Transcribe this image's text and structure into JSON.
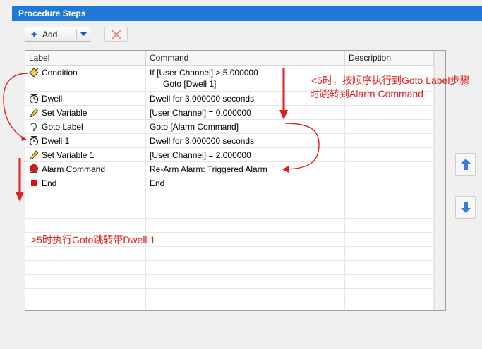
{
  "panel": {
    "title": "Procedure Steps"
  },
  "toolbar": {
    "add_label": "Add",
    "add_plus": "+"
  },
  "columns": [
    "Label",
    "Command",
    "Description"
  ],
  "rows": [
    {
      "label": "Condition",
      "command": "If [User Channel] > 5.000000",
      "command_line2": "Goto [Dwell 1]",
      "icon": "condition-icon"
    },
    {
      "label": "Dwell",
      "command": "Dwell for 3.000000 seconds",
      "icon": "timer-icon"
    },
    {
      "label": "Set Variable",
      "command": "[User Channel] = 0.000000",
      "icon": "pencil-icon"
    },
    {
      "label": "Goto Label",
      "command": "Goto [Alarm Command]",
      "icon": "goto-icon"
    },
    {
      "label": "Dwell 1",
      "command": "Dwell for 3.000000 seconds",
      "icon": "timer-icon"
    },
    {
      "label": "Set Variable 1",
      "command": "[User Channel] = 2.000000",
      "icon": "pencil-icon"
    },
    {
      "label": "Alarm Command",
      "command": "Re-Arm Alarm: Triggered Alarm",
      "icon": "alarm-icon"
    },
    {
      "label": "End",
      "command": "End",
      "icon": "stop-icon"
    }
  ],
  "annotations": {
    "right_line1": "<5时，按顺序执行到Goto Label步骤",
    "right_line2": "时跳转到Alarm Command",
    "bottom": ">5时执行Goto跳转带Dwell 1"
  },
  "colors": {
    "title_bar": "#1e7ad6",
    "annotation": "#e02020",
    "arrow_button": "#3a7be0"
  }
}
